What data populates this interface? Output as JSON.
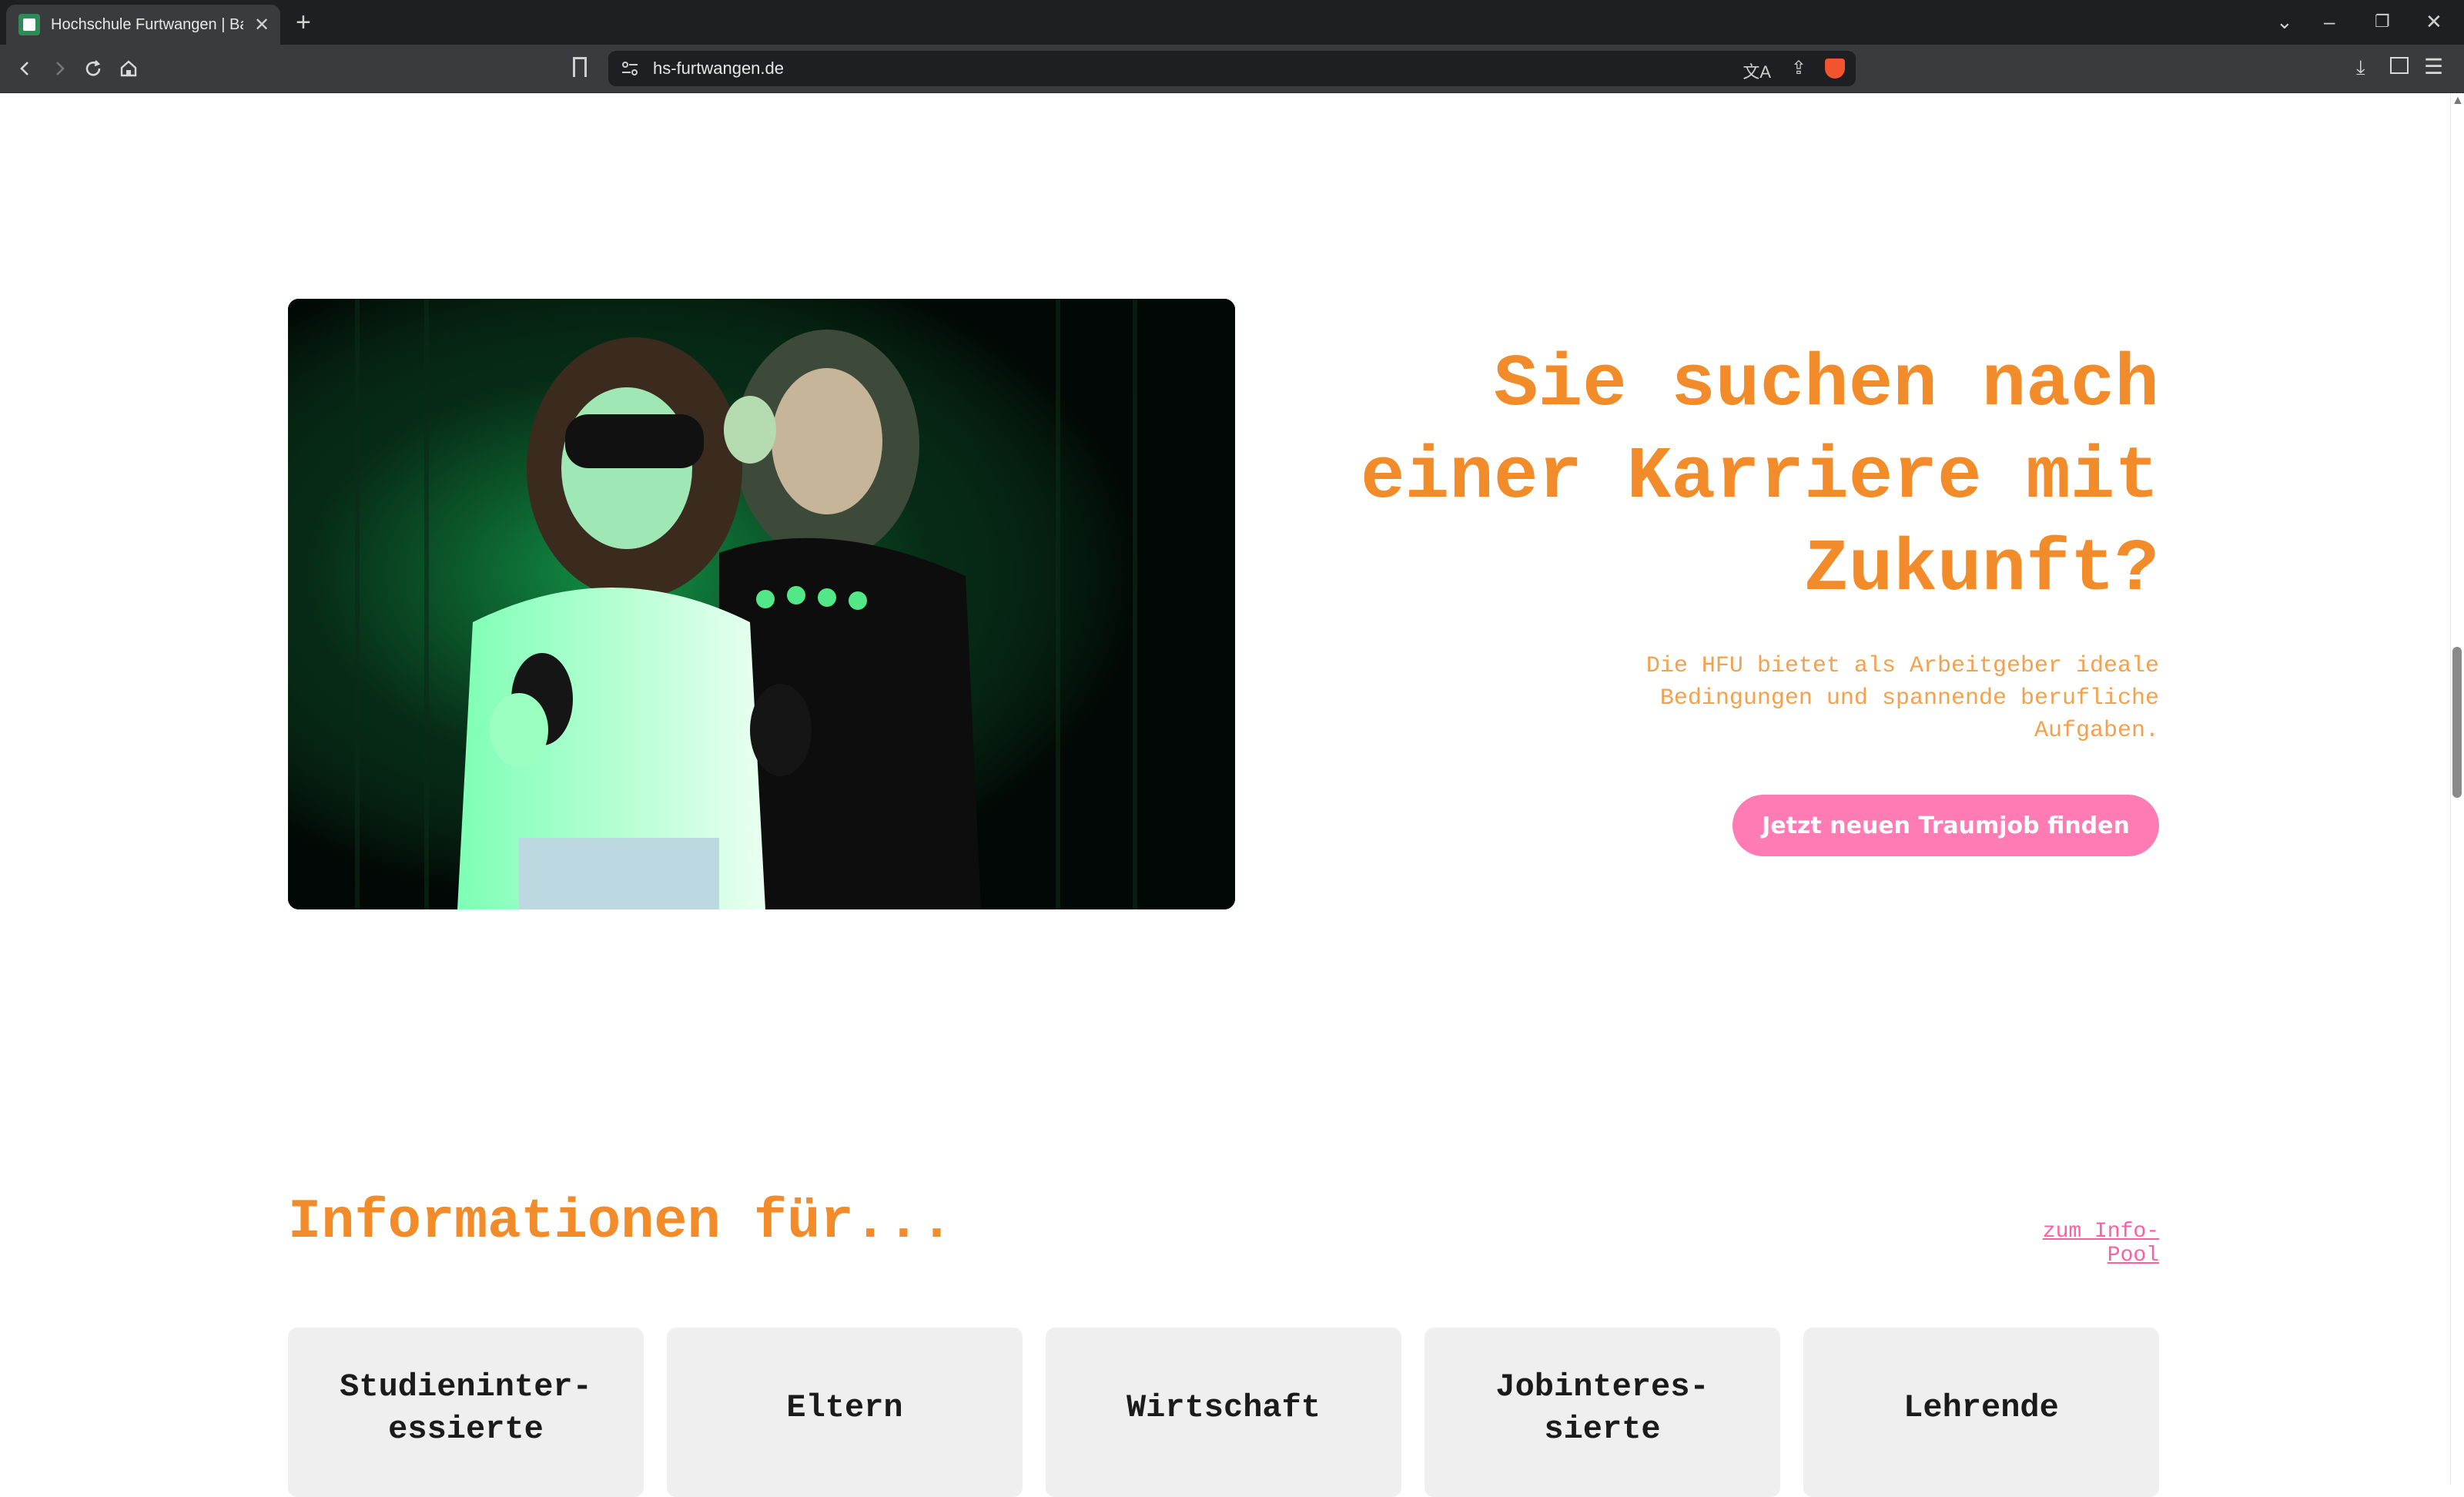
{
  "browser": {
    "tab_title": "Hochschule Furtwangen | Baden",
    "url": "hs-furtwangen.de"
  },
  "hero": {
    "headline": "Sie suchen nach einer Karriere mit Zukunft?",
    "subtext": "Die HFU bietet als Arbeitgeber ideale Bedingungen und spannende berufliche Aufgaben.",
    "cta_label": "Jetzt neuen Traumjob finden",
    "image_alt": "hero-photo-vr-headset"
  },
  "info": {
    "title": "Informationen für...",
    "link_label": "zum Info-Pool",
    "cards": [
      {
        "label": "Studieninter-\nessierte"
      },
      {
        "label": "Eltern"
      },
      {
        "label": "Wirtschaft"
      },
      {
        "label": "Jobinteres-\nsierte"
      },
      {
        "label": "Lehrende"
      }
    ]
  },
  "colors": {
    "accent_orange": "#f28c2a",
    "accent_pink": "#ff7bb3",
    "card_bg": "#efefef"
  }
}
